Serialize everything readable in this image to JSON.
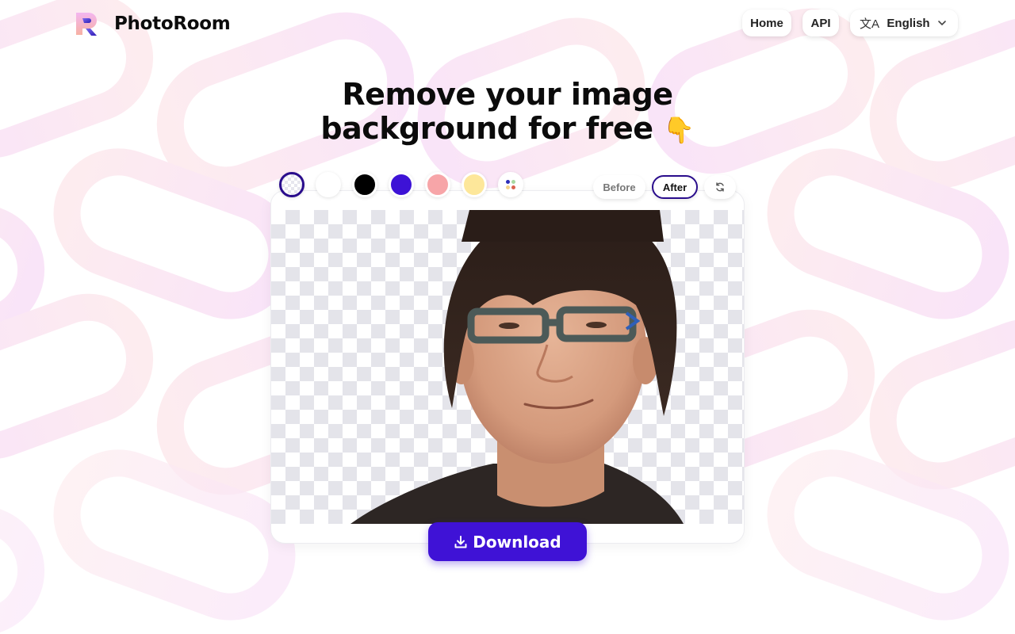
{
  "app": {
    "name": "PhotoRoom"
  },
  "nav": {
    "home_label": "Home",
    "api_label": "API",
    "language": {
      "icon": "translate-icon",
      "icon_glyph": "文A",
      "selected": "English"
    }
  },
  "hero": {
    "title_line1": "Remove your image",
    "title_line2": "background for free",
    "emoji": "👇"
  },
  "background_swatches": [
    {
      "name": "transparent",
      "color": "transparent",
      "selected": true
    },
    {
      "name": "white",
      "color": "#ffffff",
      "selected": false
    },
    {
      "name": "black",
      "color": "#000000",
      "selected": false
    },
    {
      "name": "purple",
      "color": "#3d12d6",
      "selected": false
    },
    {
      "name": "pink",
      "color": "#f7a5a8",
      "selected": false
    },
    {
      "name": "yellow",
      "color": "#fde79a",
      "selected": false
    },
    {
      "name": "more-colors",
      "dots": [
        "#2d2eb8",
        "#a8d8a0",
        "#f5d48a",
        "#d9634f"
      ],
      "selected": false
    }
  ],
  "view_toggle": {
    "before_label": "Before",
    "after_label": "After",
    "active": "After",
    "swap_icon": "refresh-icon"
  },
  "preview": {
    "alt": "Portrait of a man with glasses, background removed"
  },
  "download": {
    "label": "Download",
    "icon": "download-icon"
  },
  "colors": {
    "accent": "#3f12d6",
    "accent_dark": "#2a0d8c",
    "pattern_pink": "#fdeaf0",
    "pattern_violet": "#f9e6fb"
  }
}
